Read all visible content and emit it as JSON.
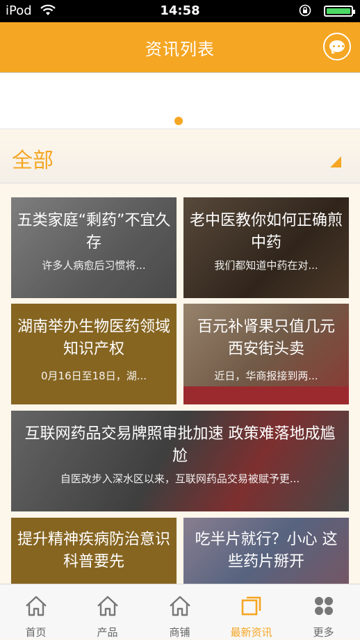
{
  "status": {
    "carrier": "iPod",
    "time": "14:58"
  },
  "header": {
    "title": "资讯列表",
    "chat_icon": "chat-bubble-icon"
  },
  "filter": {
    "label": "全部"
  },
  "articles": [
    {
      "title": "五类家庭“剩药”不宜久存",
      "summary": "许多人病愈后习惯将..."
    },
    {
      "title": "老中医教你如何正确煎中药",
      "summary": "我们都知道中药在对..."
    },
    {
      "title": "湖南举办生物医药领域知识产权",
      "summary": "0月16日至18日，湖..."
    },
    {
      "title": "百元补肾果只值几元 西安街头卖",
      "summary": "近日，华商报接到两..."
    },
    {
      "title": "互联网药品交易牌照审批加速 政策难落地成尴尬",
      "summary": "自医改步入深水区以来，互联网药品交易被赋予更..."
    },
    {
      "title": "提升精神疾病防治意识 科普要先",
      "summary": ""
    },
    {
      "title": "吃半片就行？小心 这些药片掰开",
      "summary": ""
    }
  ],
  "tabs": [
    {
      "label": "首页",
      "icon": "home-icon"
    },
    {
      "label": "产品",
      "icon": "home-icon"
    },
    {
      "label": "商铺",
      "icon": "home-icon"
    },
    {
      "label": "最新资讯",
      "icon": "news-icon"
    },
    {
      "label": "更多",
      "icon": "grid-icon"
    }
  ],
  "colors": {
    "accent": "#f5a623",
    "card_gold": "#866521",
    "background": "#fdf6ea"
  }
}
